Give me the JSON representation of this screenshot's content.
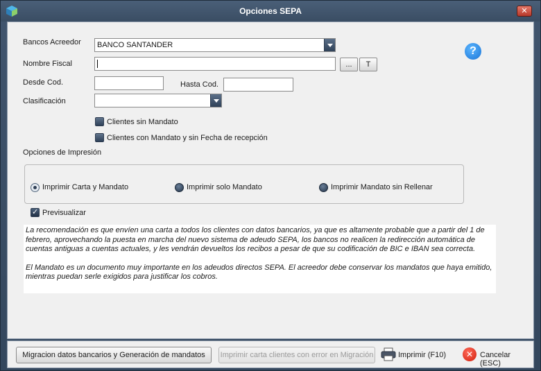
{
  "window": {
    "title": "Opciones SEPA",
    "close_symbol": "✕"
  },
  "form": {
    "bancos_label": "Bancos Acreedor",
    "bancos_value": "BANCO SANTANDER",
    "nombre_label": "Nombre Fiscal",
    "nombre_value": "",
    "browse_label": "...",
    "t_label": "T",
    "desde_label": "Desde Cod.",
    "desde_value": "",
    "hasta_label": "Hasta Cod.",
    "hasta_value": "",
    "clasif_label": "Clasificación",
    "clasif_value": "",
    "help_symbol": "?"
  },
  "checks": {
    "sin_mandato": {
      "label": "Clientes sin Mandato",
      "checked": false
    },
    "con_mandato": {
      "label": "Clientes con Mandato y sin Fecha de recepción",
      "checked": false
    },
    "previsualizar": {
      "label": "Previsualizar",
      "checked": true
    }
  },
  "impresion": {
    "heading": "Opciones de Impresión",
    "options": [
      {
        "label": "Imprimir Carta y Mandato",
        "selected": true
      },
      {
        "label": "Imprimir solo Mandato",
        "selected": false
      },
      {
        "label": "Imprimir Mandato sin Rellenar",
        "selected": false
      }
    ]
  },
  "note": {
    "p1": "La recomendación es que envíen una carta a todos los clientes con datos bancarios, ya que es altamente probable que a partir del 1 de febrero, aprovechando la puesta en marcha del nuevo sistema de adeudo SEPA, los bancos  no realicen la redirección automática de cuentas antiguas a cuentas actuales, y les vendrán devueltos los recibos a pesar de que su codificación de BIC e IBAN sea correcta.",
    "p2": "El Mandato es un documento muy importante en los adeudos directos SEPA. El acreedor debe conservar los mandatos que haya emitido, mientras puedan serle exigidos para justificar los cobros."
  },
  "footer": {
    "migracion_label": "Migracion datos bancarios  y Generación de mandatos",
    "imprimir_carta_label": "Imprimir carta clientes con error en Migración",
    "imprimir_label": "Imprimir (F10)",
    "cancelar_label": "Cancelar (ESC)",
    "cancel_symbol": "✕"
  },
  "colors": {
    "accent": "#3a4d63",
    "help_blue": "#1a74d6",
    "cancel_red": "#d11d0b"
  }
}
